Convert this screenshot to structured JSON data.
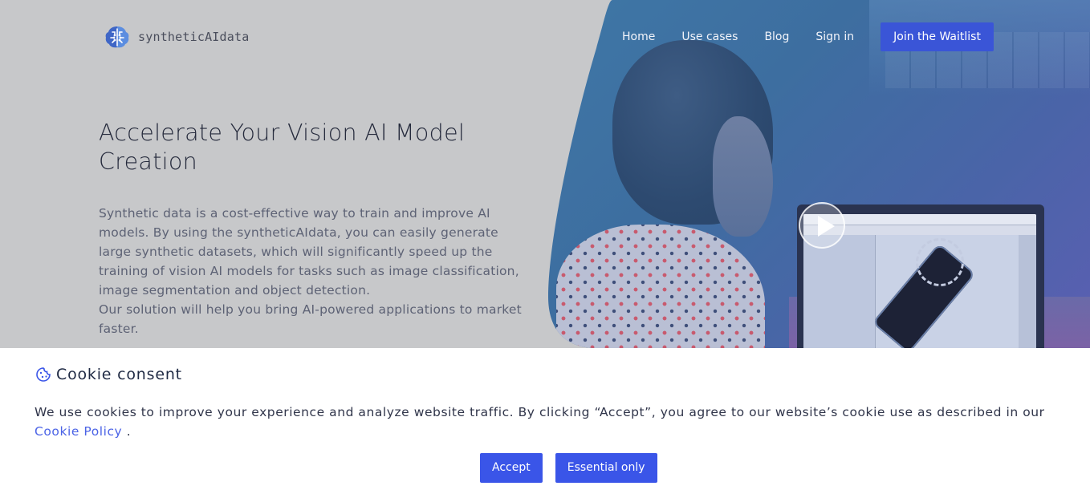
{
  "brand": {
    "name": "syntheticAIdata",
    "logo_icon": "brain-circuit-icon",
    "accent_color": "#3a55d7"
  },
  "nav": {
    "items": [
      {
        "label": "Home"
      },
      {
        "label": "Use cases"
      },
      {
        "label": "Blog"
      },
      {
        "label": "Sign in"
      }
    ],
    "cta_label": "Join the Waitlist"
  },
  "hero": {
    "headline": "Accelerate Your Vision AI Model Creation",
    "description_p1": "Synthetic data is a cost-effective way to train and improve AI models. By using the syntheticAIdata, you can easily generate large synthetic datasets, which will significantly speed up the training of vision AI models for tasks such as image classification, image segmentation and object detection.",
    "description_p2": "Our solution will help you bring AI-powered applications to market faster.",
    "video_icon": "play-icon"
  },
  "cookie": {
    "icon": "cookie-icon",
    "title": "Cookie consent",
    "text": "We use cookies to improve your experience and analyze website traffic. By clicking “Accept”, you agree to our website’s cookie use as described in our",
    "link_label": "Cookie Policy",
    "text_end": ".",
    "accept_label": "Accept",
    "essential_label": "Essential only"
  }
}
